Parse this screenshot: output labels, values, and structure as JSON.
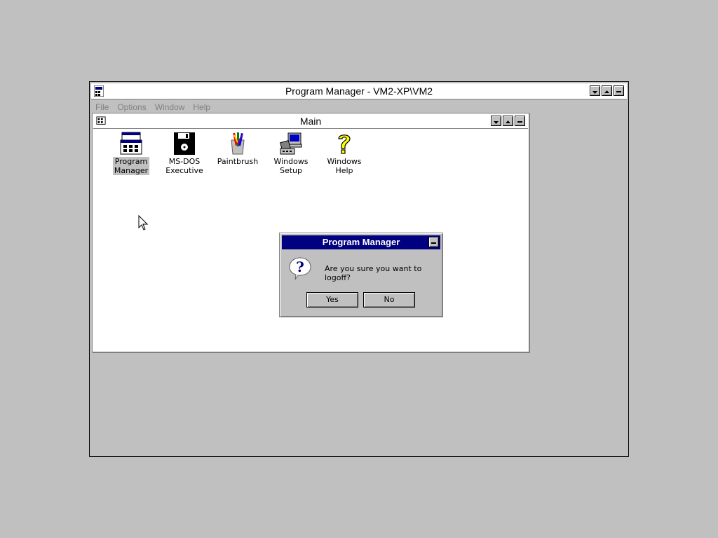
{
  "program_manager": {
    "title": "Program Manager - VM2-XP\\VM2",
    "menu": [
      "File",
      "Options",
      "Window",
      "Help"
    ]
  },
  "main_group": {
    "title": "Main",
    "icons": [
      {
        "label_line1": "Program",
        "label_line2": "Manager",
        "icon": "program-manager-icon",
        "selected": true
      },
      {
        "label_line1": "MS-DOS",
        "label_line2": "Executive",
        "icon": "floppy-disk-icon",
        "selected": false
      },
      {
        "label_line1": "Paintbrush",
        "label_line2": "",
        "icon": "paintbrush-icon",
        "selected": false
      },
      {
        "label_line1": "Windows",
        "label_line2": "Setup",
        "icon": "windows-setup-icon",
        "selected": false
      },
      {
        "label_line1": "Windows",
        "label_line2": "Help",
        "icon": "help-question-icon",
        "selected": false
      }
    ]
  },
  "dialog": {
    "title": "Program Manager",
    "message": "Are you sure you want to logoff?",
    "yes_label": "Yes",
    "no_label": "No",
    "icon": "question-icon"
  },
  "colors": {
    "desktop": "#c0c0c0",
    "active_title": "#000080",
    "inactive_title": "#ffffff"
  }
}
